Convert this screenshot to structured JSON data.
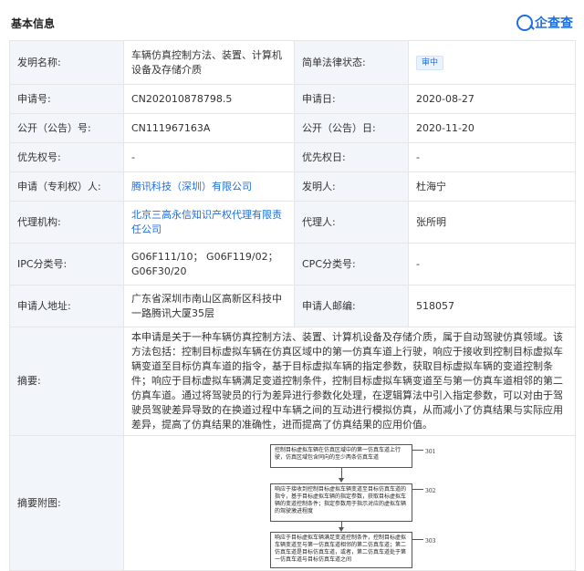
{
  "section": {
    "title": "基本信息"
  },
  "brand": {
    "name": "企查查",
    "color": "#1f6fe0"
  },
  "rows": {
    "title_label": "发明名称:",
    "title_value": "车辆仿真控制方法、装置、计算机设备及存储介质",
    "legal_status_label": "简单法律状态:",
    "legal_status_value": "审中",
    "app_no_label": "申请号:",
    "app_no_value": "CN202010878798.5",
    "app_date_label": "申请日:",
    "app_date_value": "2020-08-27",
    "pub_no_label": "公开（公告）号:",
    "pub_no_value": "CN111967163A",
    "pub_date_label": "公开（公告）日:",
    "pub_date_value": "2020-11-20",
    "priority_no_label": "优先权号:",
    "priority_no_value": "-",
    "priority_date_label": "优先权日:",
    "priority_date_value": "-",
    "applicant_label": "申请（专利权）人:",
    "applicant_value": "腾讯科技（深圳）有限公司",
    "inventor_label": "发明人:",
    "inventor_value": "杜海宁",
    "agency_label": "代理机构:",
    "agency_value": "北京三高永信知识产权代理有限责任公司",
    "agent_label": "代理人:",
    "agent_value": "张所明",
    "ipc_label": "IPC分类号:",
    "ipc_value": "G06F111/10； G06F119/02； G06F30/20",
    "cpc_label": "CPC分类号:",
    "cpc_value": "-",
    "address_label": "申请人地址:",
    "address_value": "广东省深圳市南山区高新区科技中一路腾讯大厦35层",
    "postcode_label": "申请人邮编:",
    "postcode_value": "518057",
    "abstract_label": "摘要:",
    "abstract_value": "本申请是关于一种车辆仿真控制方法、装置、计算机设备及存储介质，属于自动驾驶仿真领域。该方法包括：控制目标虚拟车辆在仿真区域中的第一仿真车道上行驶，响应于接收到控制目标虚拟车辆变道至目标仿真车道的指令，基于目标虚拟车辆的指定参数，获取目标虚拟车辆的变道控制条件；响应于目标虚拟车辆满足变道控制条件，控制目标虚拟车辆变道至与第一仿真车道相邻的第二仿真车道。通过将驾驶员的行为差异进行参数化处理，在逻辑算法中引入指定参数，可以对由于驾驶员驾驶差异导致的在换道过程中车辆之间的互动进行模拟仿真，从而减小了仿真结果与实际应用差异，提高了仿真结果的准确性，进而提高了仿真结果的应用价值。",
    "figure_label": "摘要附图:"
  },
  "figure": {
    "box1_text": "控制目标虚拟车辆在仿真区域中的第一仿真车道上行驶，仿真区域包含同向的至少两条仿真车道",
    "box1_num": "301",
    "box2_text": "响应于接收到控制目标虚拟车辆变道至目标仿真车道的指令，基于目标虚拟车辆的指定参数，获取目标虚拟车辆的变道控制条件；指定参数用于指示对应的虚拟车辆的驾驶激进程度",
    "box2_num": "302",
    "box3_text": "响应于目标虚拟车辆满足变道控制条件，控制目标虚拟车辆变道至与第一仿真车道相邻的第二仿真车道；第二仿真车道是目标仿真车道，或者，第二仿真车道处于第一仿真车道与目标仿真车道之间",
    "box3_num": "303"
  }
}
